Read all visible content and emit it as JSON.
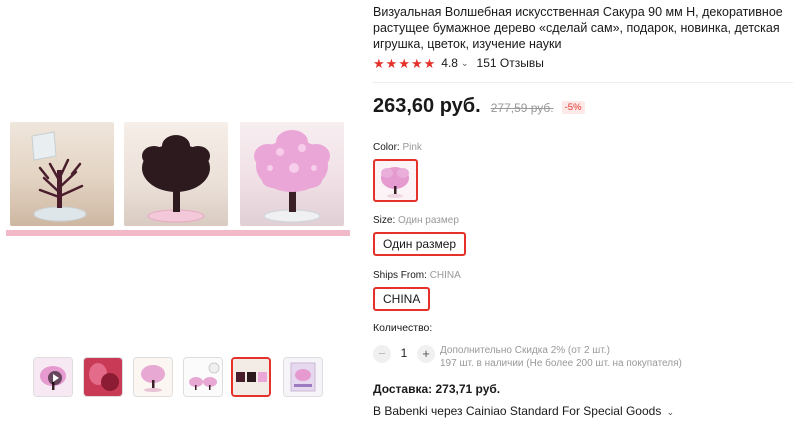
{
  "product": {
    "title": "Визуальная Волшебная искусственная Сакура 90 мм H, декоративное растущее бумажное дерево «сделай сам», подарок, новинка, детская игрушка, цветок, изучение науки",
    "rating": "4.8",
    "reviews": "151 Отзывы"
  },
  "price": {
    "current": "263,60 руб.",
    "old": "277,59 руб.",
    "discount": "-5%"
  },
  "options": {
    "color_label": "Color:",
    "color_value": "Pink",
    "size_label": "Size:",
    "size_value": "Один размер",
    "size_button": "Один размер",
    "ships_label": "Ships From:",
    "ships_value": "CHINA",
    "ships_button": "CHINA"
  },
  "quantity": {
    "label": "Количество:",
    "value": "1",
    "minus": "−",
    "plus": "+",
    "discount_note": "Дополнительно Скидка 2% (от 2 шт.)",
    "stock_note": "197 шт. в наличии (Не более 200 шт. на покупателя)"
  },
  "delivery": {
    "cost": "Доставка: 273,71 руб.",
    "method": "В Babenki через Cainiao Standard For Special Goods"
  },
  "gallery": {
    "thumbnail_count": 6,
    "selected_thumbnail": 5
  },
  "colors": {
    "accent": "#e4322b",
    "rating_star": "#e4322b",
    "blossom_pink": "#e9a6d7",
    "tree_dark": "#3a1a26"
  }
}
